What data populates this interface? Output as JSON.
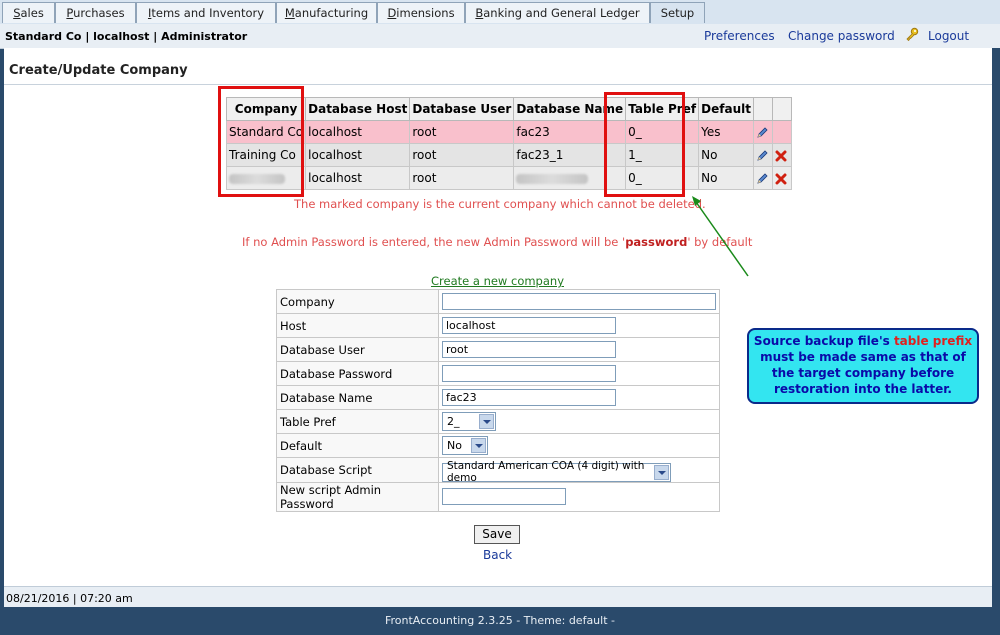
{
  "tabs": [
    {
      "label": "Sales",
      "underline": "S",
      "rest": "ales",
      "active": false
    },
    {
      "label": "Purchases",
      "underline": "P",
      "rest": "urchases",
      "active": false
    },
    {
      "label": "Items and Inventory",
      "underline": "I",
      "rest": "tems and Inventory",
      "active": false
    },
    {
      "label": "Manufacturing",
      "underline": "M",
      "rest": "anufacturing",
      "active": false
    },
    {
      "label": "Dimensions",
      "underline": "D",
      "rest": "imensions",
      "active": false
    },
    {
      "label": "Banking and General Ledger",
      "underline": "B",
      "rest": "anking and General Ledger",
      "active": false
    },
    {
      "label": "Setup",
      "underline": "",
      "rest": "Setup",
      "active": true
    }
  ],
  "header": {
    "context": "Standard Co | localhost | Administrator",
    "preferences": "Preferences",
    "change_password": "Change password",
    "logout": "Logout"
  },
  "page": {
    "title": "Create/Update Company"
  },
  "company_table": {
    "columns": [
      "Company",
      "Database Host",
      "Database User",
      "Database Name",
      "Table Pref",
      "Default",
      "",
      ""
    ],
    "rows": [
      {
        "company": "Standard Co",
        "host": "localhost",
        "user": "root",
        "dbname": "fac23",
        "pref": "0_",
        "default": "Yes",
        "deletable": false,
        "company_blurred": false,
        "dbname_blurred": false
      },
      {
        "company": "Training Co",
        "host": "localhost",
        "user": "root",
        "dbname": "fac23_1",
        "pref": "1_",
        "default": "No",
        "deletable": true,
        "company_blurred": false,
        "dbname_blurred": false
      },
      {
        "company": "",
        "host": "localhost",
        "user": "root",
        "dbname": "",
        "pref": "0_",
        "default": "No",
        "deletable": true,
        "company_blurred": true,
        "dbname_blurred": true
      }
    ],
    "current_note": "The marked company is the current company which cannot be deleted.",
    "admin_note_prefix": "If no Admin Password is entered, the new Admin Password will be '",
    "admin_note_bold": "password",
    "admin_note_suffix": "' by default"
  },
  "create_link": "Create a new company",
  "form": {
    "company": {
      "label": "Company",
      "value": ""
    },
    "host": {
      "label": "Host",
      "value": "localhost"
    },
    "db_user": {
      "label": "Database User",
      "value": "root"
    },
    "db_password": {
      "label": "Database Password",
      "value": ""
    },
    "db_name": {
      "label": "Database Name",
      "value": "fac23"
    },
    "table_pref": {
      "label": "Table Pref",
      "value": "2_"
    },
    "default": {
      "label": "Default",
      "value": "No"
    },
    "db_script": {
      "label": "Database Script",
      "value": "Standard American COA (4 digit) with demo"
    },
    "admin_password": {
      "label": "New script Admin Password",
      "value": ""
    }
  },
  "buttons": {
    "save": "Save",
    "back": "Back"
  },
  "callout": {
    "prefix": "Source backup file's ",
    "highlight": "table prefix",
    "suffix": " must be made same as that of the target company before restoration into the latter."
  },
  "status_bar": {
    "datetime": "08/21/2016 | 07:20 am"
  },
  "footer": "FrontAccounting 2.3.25 - Theme: default -",
  "colors": {
    "current_row": "#f9c0cc",
    "highlight_box": "#e01010",
    "note_text": "#e05050",
    "callout_bg": "#33e5f0",
    "arrow": "#1a8a1a"
  }
}
